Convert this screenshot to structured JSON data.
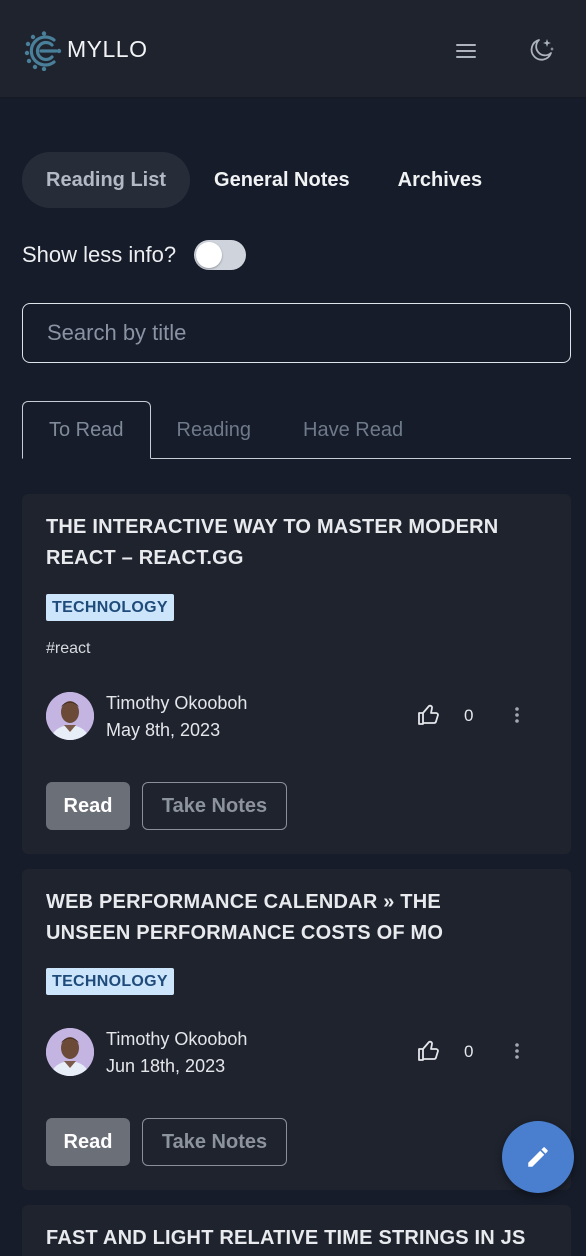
{
  "header": {
    "brand": "MYLLO",
    "menu_icon": "hamburger-menu-icon",
    "theme_icon": "moon-stars-icon"
  },
  "main_tabs": [
    {
      "label": "Reading List",
      "active": true
    },
    {
      "label": "General Notes",
      "active": false
    },
    {
      "label": "Archives",
      "active": false
    }
  ],
  "toggle": {
    "label": "Show less info?",
    "checked": false
  },
  "search": {
    "placeholder": "Search by title",
    "value": ""
  },
  "sub_tabs": [
    {
      "label": "To Read",
      "active": true
    },
    {
      "label": "Reading",
      "active": false
    },
    {
      "label": "Have Read",
      "active": false
    }
  ],
  "cards": [
    {
      "title": "THE INTERACTIVE WAY TO MASTER MODERN REACT – REACT.GG",
      "category": "TECHNOLOGY",
      "tag": "#react",
      "author": "Timothy Okooboh",
      "date": "May 8th, 2023",
      "likes": "0",
      "read_label": "Read",
      "notes_label": "Take Notes"
    },
    {
      "title": "WEB PERFORMANCE CALENDAR » THE UNSEEN PERFORMANCE COSTS OF MO",
      "category": "TECHNOLOGY",
      "author": "Timothy Okooboh",
      "date": "Jun 18th, 2023",
      "likes": "0",
      "read_label": "Read",
      "notes_label": "Take Notes"
    },
    {
      "title": "FAST AND LIGHT RELATIVE TIME STRINGS IN JS"
    }
  ],
  "fab": {
    "icon": "pencil-icon"
  },
  "colors": {
    "background": "#161c29",
    "card": "#1e232e",
    "badge_bg": "#cde5fb",
    "fab": "#4a7fcf"
  }
}
